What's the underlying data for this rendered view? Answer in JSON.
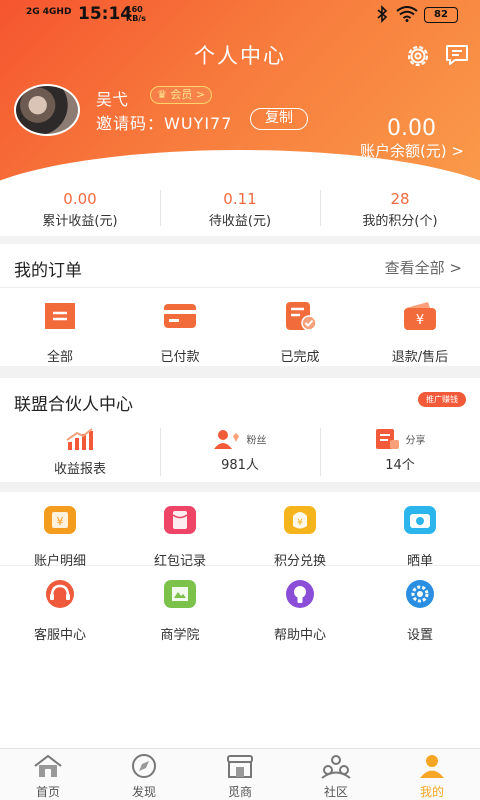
{
  "statusbar": {
    "network": "2G 4GHD",
    "time": "15:14",
    "speed": "160\nKB/s",
    "battery": "82"
  },
  "header": {
    "title": "个人中心"
  },
  "profile": {
    "username": "吴弋",
    "vip_badge": "会员 >",
    "invite_label": "邀请码：",
    "invite_code": "WUYI77",
    "copy_label": "复制",
    "balance_value": "0.00",
    "balance_label": "账户余额(元) >"
  },
  "earnings": [
    {
      "value": "0.00",
      "label": "累计收益(元)"
    },
    {
      "value": "0.11",
      "label": "待收益(元)"
    },
    {
      "value": "28",
      "label": "我的积分(个)"
    }
  ],
  "orders": {
    "title": "我的订单",
    "more": "查看全部 >",
    "items": [
      {
        "label": "全部",
        "icon": "all-orders-icon"
      },
      {
        "label": "已付款",
        "icon": "paid-icon"
      },
      {
        "label": "已完成",
        "icon": "completed-icon"
      },
      {
        "label": "退款/售后",
        "icon": "refund-icon"
      }
    ]
  },
  "partner": {
    "title": "联盟合伙人中心",
    "tag": "推广赚钱",
    "items": [
      {
        "caption": "",
        "value": "收益报表",
        "icon": "report-chart-icon"
      },
      {
        "caption": "粉丝",
        "value": "981人",
        "icon": "fans-icon"
      },
      {
        "caption": "分享",
        "value": "14个",
        "icon": "share-icon"
      }
    ]
  },
  "tools": {
    "row1": [
      {
        "label": "账户明细",
        "icon": "account-detail-icon"
      },
      {
        "label": "红包记录",
        "icon": "red-packet-icon"
      },
      {
        "label": "积分兑换",
        "icon": "points-exchange-icon"
      },
      {
        "label": "晒单",
        "icon": "camera-icon"
      }
    ],
    "row2": [
      {
        "label": "客服中心",
        "icon": "customer-service-icon"
      },
      {
        "label": "商学院",
        "icon": "business-school-icon"
      },
      {
        "label": "帮助中心",
        "icon": "help-icon"
      },
      {
        "label": "设置",
        "icon": "settings-icon"
      }
    ]
  },
  "tabbar": [
    {
      "label": "首页",
      "icon": "home-icon"
    },
    {
      "label": "发现",
      "icon": "compass-icon"
    },
    {
      "label": "觅商",
      "icon": "shop-icon"
    },
    {
      "label": "社区",
      "icon": "community-icon"
    },
    {
      "label": "我的",
      "icon": "me-icon",
      "active": true
    }
  ],
  "colors": {
    "accent": "#f5552f",
    "value_orange": "#ee6a43",
    "tab_active": "#f5a623"
  }
}
